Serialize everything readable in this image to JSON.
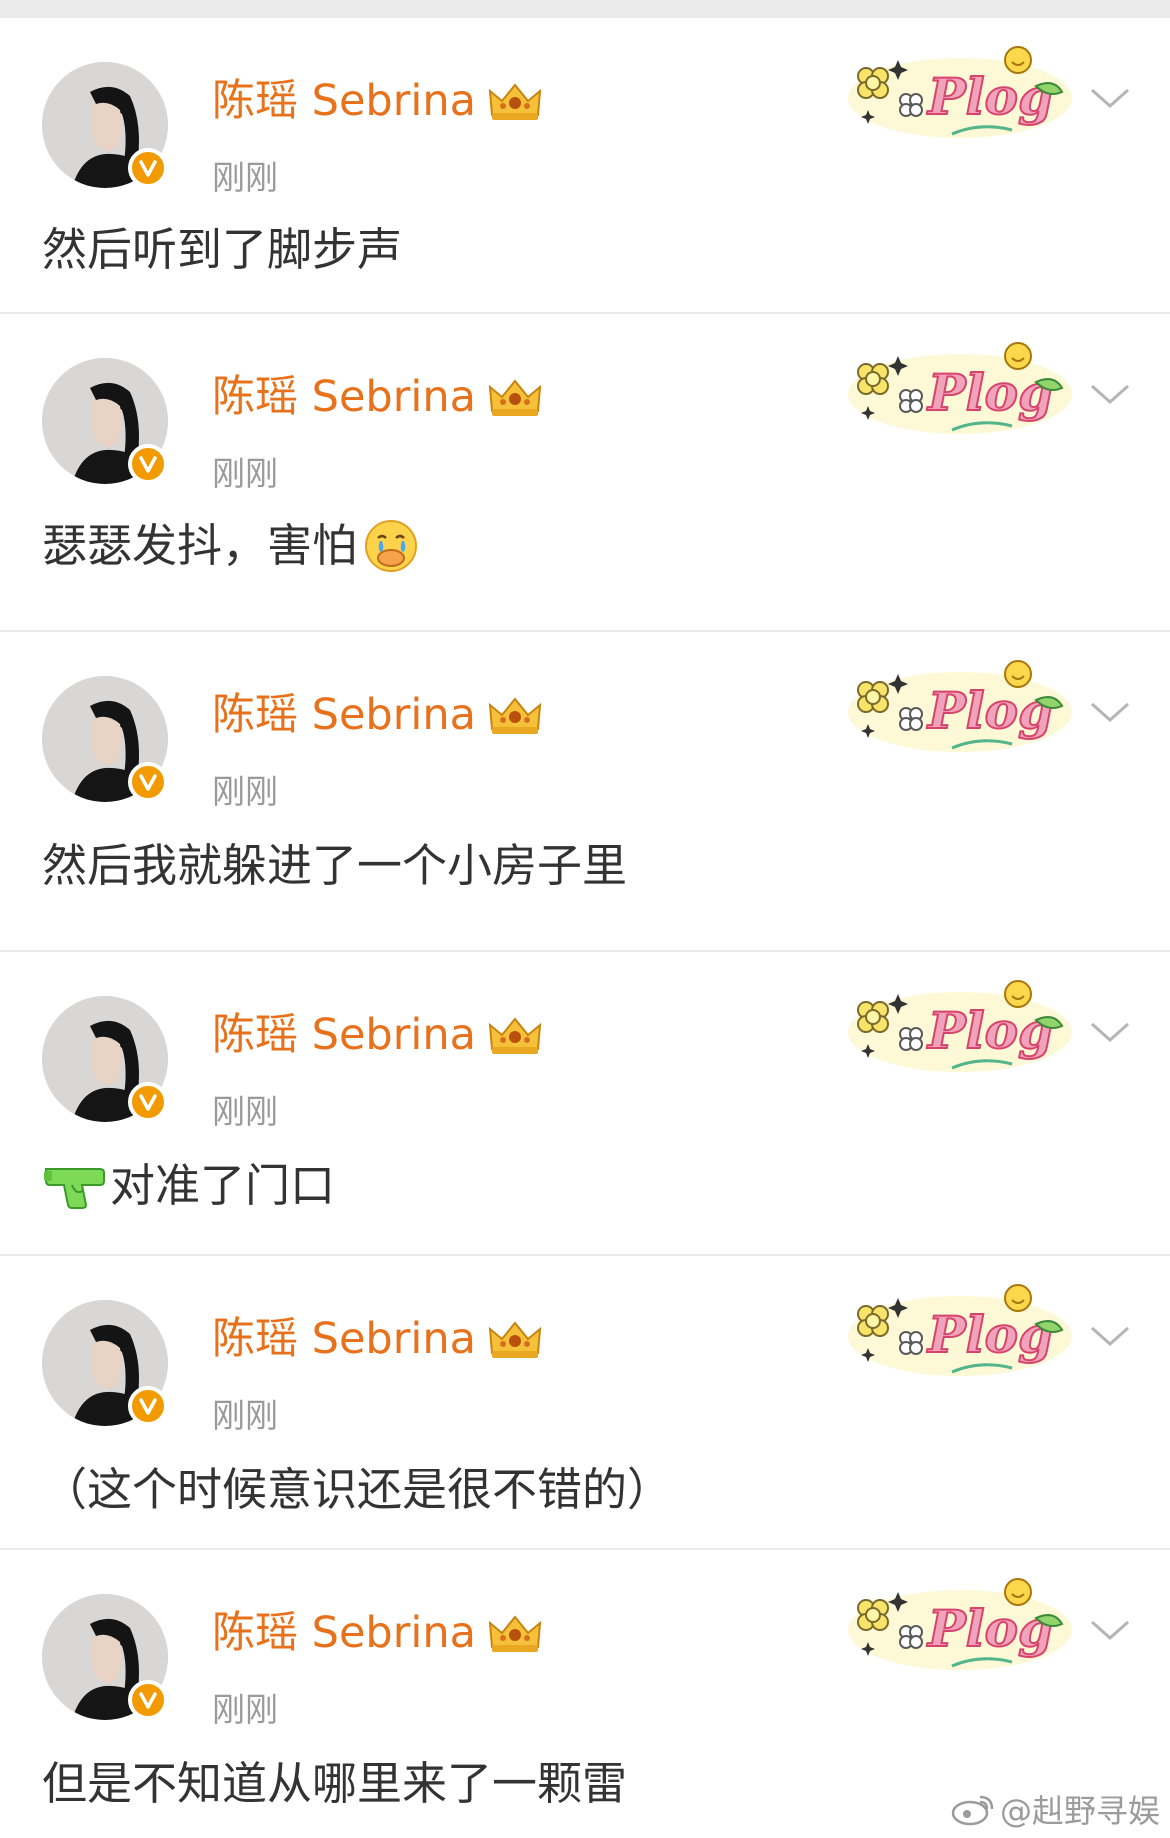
{
  "posts": [
    {
      "username": "陈瑶 Sebrina",
      "timestamp": "刚刚",
      "content": "然后听到了脚步声",
      "emoji": ""
    },
    {
      "username": "陈瑶 Sebrina",
      "timestamp": "刚刚",
      "content": "瑟瑟发抖，害怕",
      "emoji": "crying-cover-mouth-icon"
    },
    {
      "username": "陈瑶 Sebrina",
      "timestamp": "刚刚",
      "content": "然后我就躲进了一个小房子里",
      "emoji": ""
    },
    {
      "username": "陈瑶 Sebrina",
      "timestamp": "刚刚",
      "content": "对准了门口",
      "emoji": "water-pistol-icon"
    },
    {
      "username": "陈瑶 Sebrina",
      "timestamp": "刚刚",
      "content": "（这个时候意识还是很不错的）",
      "emoji": ""
    },
    {
      "username": "陈瑶 Sebrina",
      "timestamp": "刚刚",
      "content": "但是不知道从哪里来了一颗雷",
      "emoji": ""
    }
  ],
  "decor": {
    "plog_text": "Plog"
  },
  "watermark": {
    "text": "@赳野寻娱"
  },
  "colors": {
    "username": "#e8721c",
    "timestamp": "#9a9a9a",
    "content": "#333333",
    "verified_badge": "#f39a00",
    "background": "#ebebeb"
  },
  "icons": [
    "avatar",
    "verified-v-icon",
    "crown-icon",
    "plog-sticker",
    "chevron-down-icon",
    "weibo-logo-icon"
  ]
}
